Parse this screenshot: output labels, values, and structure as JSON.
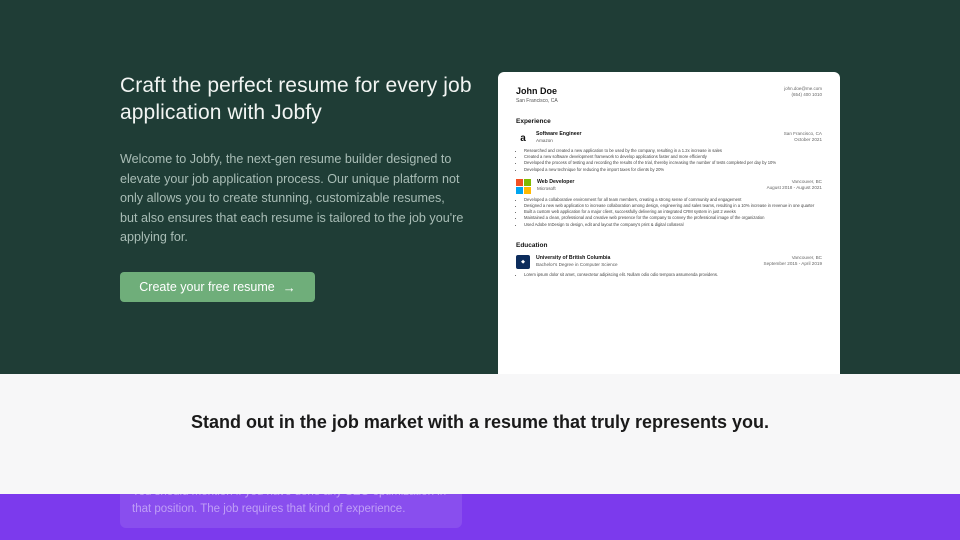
{
  "hero": {
    "title": "Craft the perfect resume for every job application with Jobfy",
    "description": "Welcome to Jobfy, the next-gen resume builder designed to elevate your job application process. Our unique platform not only allows you to create stunning, customizable resumes, but also ensures that each resume is tailored to the job you're applying for.",
    "cta_label": "Create your free resume",
    "cta_icon": "arrow-right-icon"
  },
  "resume": {
    "name": "John Doe",
    "location": "San Francisco, CA",
    "email": "john.doe@me.com",
    "phone": "(654) 400 1010",
    "experience_heading": "Experience",
    "jobs": [
      {
        "title": "Software Engineer",
        "company": "Amazon",
        "location": "San Francisco, CA",
        "date": "October 2021",
        "bullets": [
          "Researched and created a new application to be used by the company, resulting in a 1.2x increase in sales",
          "Created a new software development framework to develop applications faster and more efficiently",
          "Developed the process of testing and recording the results of the trial, thereby increasing the number of tests completed per day by 10%",
          "Developed a new technique for reducing the import taxes for clients by 20%"
        ]
      },
      {
        "title": "Web Developer",
        "company": "Microsoft",
        "location": "Vancouver, BC",
        "date": "August 2018 - August 2021",
        "bullets": [
          "Developed a collaborative environment for all team members, creating a strong sense of community and engagement",
          "Designed a new web application to increase collaboration among design, engineering and sales teams, resulting in a 10% increase in revenue in one quarter",
          "Built a custom web application for a major client, successfully delivering an integrated CRM system in just 2 weeks",
          "Maintained a clean, professional and creative web presence for the company to convey the professional image of the organization",
          "Used Adobe InDesign to design, edit and layout the company's print & digital collateral"
        ]
      }
    ],
    "education_heading": "Education",
    "education": [
      {
        "school": "University of British Columbia",
        "degree": "Bachelor's Degree in Computer Science",
        "location": "Vancouver, BC",
        "date": "September 2015 - April 2019",
        "bullets": [
          "Lorem ipsum dolor sit amet, consectetur adipiscing elit. Nullam odio odio tempora assumenda providens."
        ]
      }
    ]
  },
  "band": {
    "title": "Stand out in the job market with a resume that truly represents you."
  },
  "tip": {
    "text": "You should mention if you have done any SEO optimization in that position. The job requires that kind of experience."
  },
  "colors": {
    "hero_bg": "#1f3d36",
    "accent_green": "#6fae7a",
    "purple": "#7c3aed"
  }
}
